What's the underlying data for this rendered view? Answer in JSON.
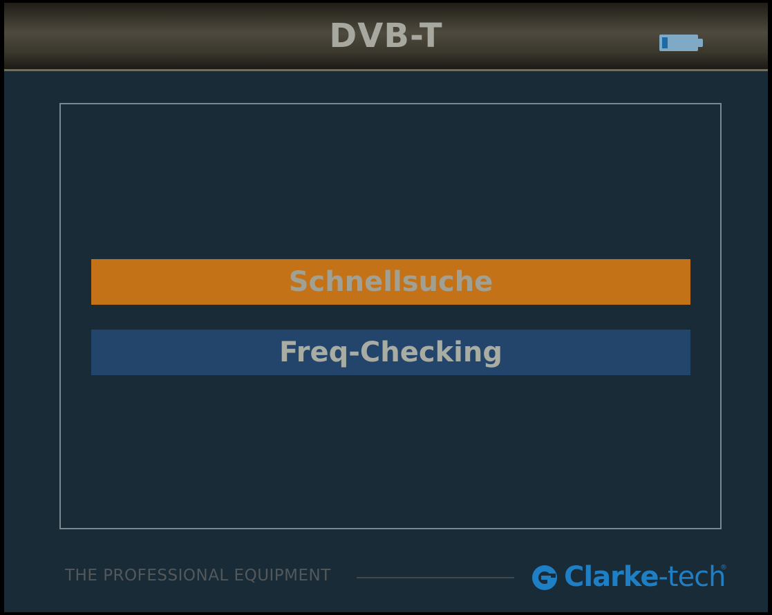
{
  "header": {
    "title": "DVB-T",
    "battery_icon": "battery-icon"
  },
  "menu": {
    "items": [
      {
        "label": "Schnellsuche",
        "selected": true
      },
      {
        "label": "Freq-Checking",
        "selected": false
      }
    ]
  },
  "footer": {
    "tagline": "THE PROFESSIONAL EQUIPMENT",
    "brand_part1": "Clarke",
    "brand_part2": "-tech",
    "brand_mark": "®"
  },
  "colors": {
    "background": "#1a2b38",
    "selected_item": "#c47218",
    "normal_item": "#23456b",
    "brand": "#1f7fc4"
  }
}
